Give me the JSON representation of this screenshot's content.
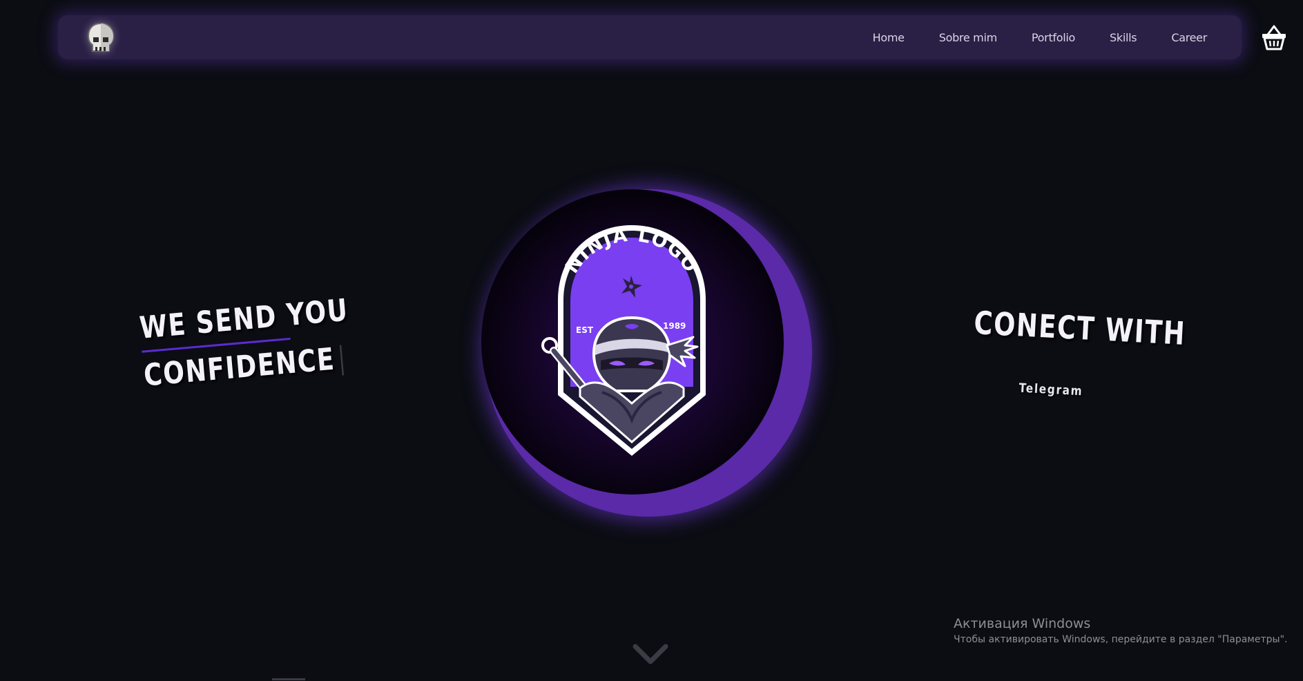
{
  "nav": {
    "logo_icon": "skull-icon",
    "links": [
      "Home",
      "Sobre mim",
      "Portfolio",
      "Skills",
      "Career"
    ],
    "cart_icon": "basket-icon"
  },
  "hero_left": {
    "line1": "WE SEND YOU",
    "line2": "CONFIDENCE"
  },
  "emblem": {
    "title": "NINJA LOGO",
    "est": "EST",
    "year": "1989",
    "icon": "ninja-icon"
  },
  "hero_right": {
    "title": "CONECT WITH",
    "link": "Telegram"
  },
  "scroll": {
    "icon": "chevron-down-icon"
  },
  "watermark": {
    "title": "Активация Windows",
    "subtitle": "Чтобы активировать Windows, перейдите в раздел \"Параметры\"."
  },
  "colors": {
    "background": "#0b0d13",
    "navbar": "#2a1f45",
    "accent": "#6a35e0",
    "glow": "#5a2aa8"
  }
}
